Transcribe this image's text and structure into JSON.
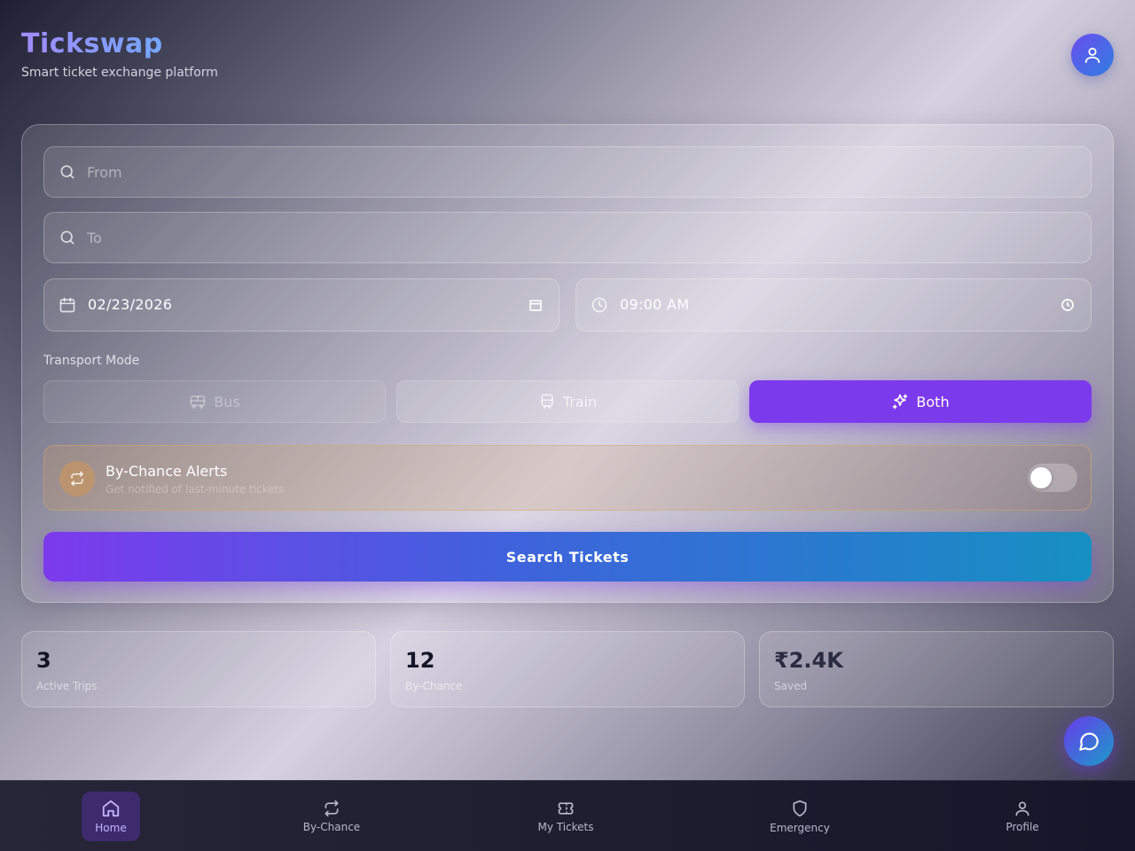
{
  "brand": {
    "title": "Tickswap",
    "subtitle": "Smart ticket exchange platform"
  },
  "search": {
    "from_placeholder": "From",
    "to_placeholder": "To",
    "date": "02/23/2026",
    "time": "09:00 AM",
    "mode_label": "Transport Mode",
    "modes": [
      {
        "label": "Bus",
        "icon": "bus-icon",
        "state": "disabled"
      },
      {
        "label": "Train",
        "icon": "train-icon",
        "state": "default"
      },
      {
        "label": "Both",
        "icon": "sparkles-icon",
        "state": "selected"
      }
    ],
    "alerts": {
      "title": "By-Chance Alerts",
      "subtitle": "Get notified of last-minute tickets",
      "enabled": false
    },
    "submit_label": "Search Tickets"
  },
  "stats": [
    {
      "value": "3",
      "label": "Active Trips"
    },
    {
      "value": "12",
      "label": "By-Chance"
    },
    {
      "value": "₹2.4K",
      "label": "Saved"
    }
  ],
  "nav": [
    {
      "label": "Home",
      "icon": "home-icon",
      "active": true
    },
    {
      "label": "By-Chance",
      "icon": "repeat-icon",
      "active": false
    },
    {
      "label": "My Tickets",
      "icon": "ticket-icon",
      "active": false
    },
    {
      "label": "Emergency",
      "icon": "shield-icon",
      "active": false
    },
    {
      "label": "Profile",
      "icon": "user-icon",
      "active": false
    }
  ],
  "colors": {
    "accent": "#7c3aed",
    "accent_end": "#1690c2",
    "nav_bg": "#1e1e30"
  }
}
